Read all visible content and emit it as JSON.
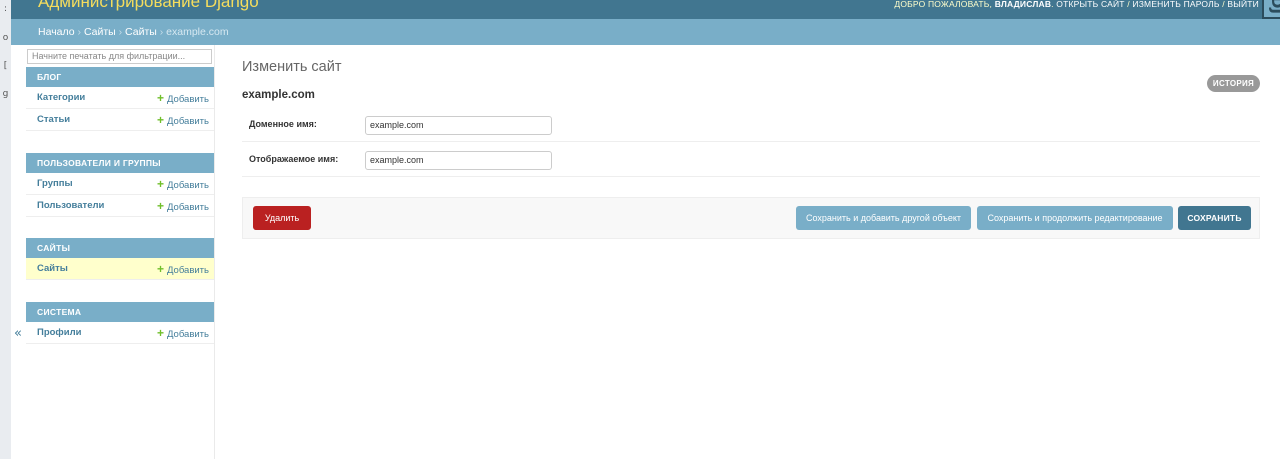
{
  "left_strip": {
    "glyphs": [
      ":",
      "o",
      "[",
      "g"
    ]
  },
  "header": {
    "brand": "Администрирование Django",
    "welcome": "ДОБРО ПОЖАЛОВАТЬ,",
    "username": "ВЛАДИСЛАВ",
    "view_site": "ОТКРЫТЬ САЙТ",
    "change_password": "ИЗМЕНИТЬ ПАРОЛЬ",
    "logout": "ВЫЙТИ",
    "separator": "/",
    "edge_glyph": "DJ"
  },
  "breadcrumbs": {
    "items": [
      "Начало",
      "Сайты",
      "Сайты"
    ],
    "separator": "›",
    "current": "example.com"
  },
  "sidebar": {
    "filter_placeholder": "Начните печатать для фильтрации...",
    "add_label": "Добавить",
    "modules": [
      {
        "caption": "БЛОГ",
        "models": [
          "Категории",
          "Статьи"
        ]
      },
      {
        "caption": "ПОЛЬЗОВАТЕЛИ И ГРУППЫ",
        "models": [
          "Группы",
          "Пользователи"
        ]
      },
      {
        "caption": "САЙТЫ",
        "models": [
          "Сайты"
        ]
      },
      {
        "caption": "СИСТЕМА",
        "models": [
          "Профили"
        ]
      }
    ],
    "collapse_glyph": "«"
  },
  "content": {
    "page_title": "Изменить сайт",
    "history": "ИСТОРИЯ",
    "object_title": "example.com",
    "fields": [
      {
        "label": "Доменное имя:",
        "value": "example.com"
      },
      {
        "label": "Отображаемое имя:",
        "value": "example.com"
      }
    ],
    "buttons": {
      "delete": "Удалить",
      "save_add": "Сохранить и добавить другой объект",
      "save_continue": "Сохранить и продолжить редактирование",
      "save": "СОХРАНИТЬ"
    }
  },
  "colors": {
    "header_bg": "#417690",
    "breadcrumbs_bg": "#79aec8",
    "brand": "#f5dd5d",
    "delete": "#ba2121",
    "current_row": "#ffffcc",
    "add_plus": "#70bf2b"
  }
}
